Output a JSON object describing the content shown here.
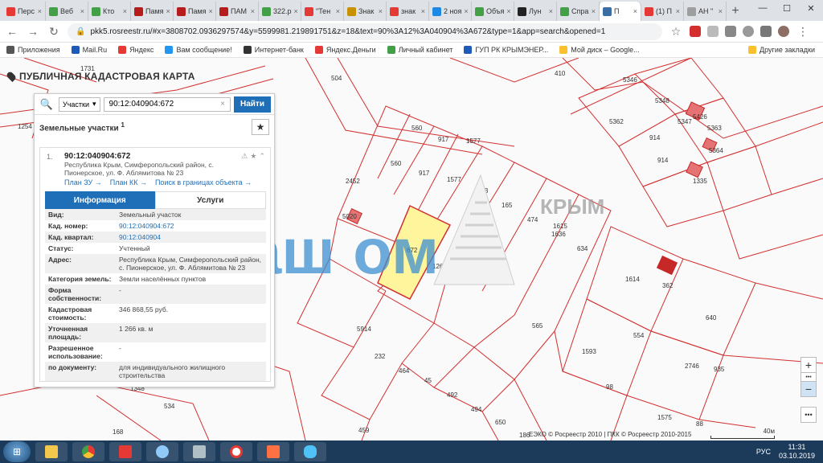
{
  "browser": {
    "tabs": [
      {
        "label": "Перс",
        "color": "#e53935"
      },
      {
        "label": "Веб",
        "color": "#43a047"
      },
      {
        "label": "Кто",
        "color": "#43a047"
      },
      {
        "label": "Памя",
        "color": "#b71c1c"
      },
      {
        "label": "Памя",
        "color": "#b71c1c"
      },
      {
        "label": "ПАМ",
        "color": "#b71c1c"
      },
      {
        "label": "322.р",
        "color": "#43a047"
      },
      {
        "label": "\"Тен",
        "color": "#e53935"
      },
      {
        "label": "Знак",
        "color": "#c79100"
      },
      {
        "label": "знак",
        "color": "#e53935"
      },
      {
        "label": "2 ноя",
        "color": "#1e88e5"
      },
      {
        "label": "Объя",
        "color": "#43a047"
      },
      {
        "label": "Лун",
        "color": "#222222"
      },
      {
        "label": "Спра",
        "color": "#43a047"
      },
      {
        "label": "П",
        "color": "#3b6fa3",
        "active": true
      },
      {
        "label": "(1) П",
        "color": "#e53935"
      },
      {
        "label": "АН \"",
        "color": "#9e9e9e"
      }
    ],
    "new_tab_label": "+",
    "url": "pkk5.rosreestr.ru/#x=3808702.0936297574&y=5599981.219891751&z=18&text=90%3A12%3A040904%3A672&type=1&app=search&opened=1",
    "bookmarks": [
      {
        "label": "Приложения",
        "color": "#555555"
      },
      {
        "label": "Mail.Ru",
        "color": "#1e5bb8"
      },
      {
        "label": "Яндекс",
        "color": "#e53935"
      },
      {
        "label": "Вам сообщение!",
        "color": "#2196f3"
      },
      {
        "label": "Интернет-банк",
        "color": "#333333"
      },
      {
        "label": "Яндекс.Деньги",
        "color": "#e53935"
      },
      {
        "label": "Личный кабинет",
        "color": "#43a047"
      },
      {
        "label": "ГУП РК КРЫМЭНЕР...",
        "color": "#1e5bb8"
      },
      {
        "label": "Мой диск – Google...",
        "color": "#fbc02d"
      }
    ],
    "other_bookmarks": "Другие закладки"
  },
  "app": {
    "title": "ПУБЛИЧНАЯ КАДАСТРОВАЯ КАРТА",
    "search": {
      "type_label": "Участки",
      "value": "90:12:040904:672",
      "button": "Найти"
    },
    "list_title": "Земельные участки",
    "list_count": "1",
    "result": {
      "index": "1.",
      "number": "90:12:040904:672",
      "address": "Республика Крым, Симферопольский район, с. Пионерское, ул. Ф. Аблямитова № 23",
      "links": [
        "План ЗУ →",
        "План КК →",
        "Поиск в границах объекта →"
      ],
      "tab_info": "Информация",
      "tab_services": "Услуги",
      "rows": [
        {
          "k": "Вид:",
          "v": "Земельный участок"
        },
        {
          "k": "Кад. номер:",
          "v": "90:12:040904:672",
          "link": true
        },
        {
          "k": "Кад. квартал:",
          "v": "90:12:040904",
          "link": true
        },
        {
          "k": "Статус:",
          "v": "Учтенный"
        },
        {
          "k": "Адрес:",
          "v": "Республика Крым, Симферопольский район, с. Пионерское, ул. Ф. Аблямитова № 23"
        },
        {
          "k": "Категория земель:",
          "v": "Земли населённых пунктов"
        },
        {
          "k": "Форма собственности:",
          "v": "-"
        },
        {
          "k": "Кадастровая стоимость:",
          "v": "346 868,55 руб."
        },
        {
          "k": "Уточненная площадь:",
          "v": "1 266 кв. м"
        },
        {
          "k": "Разрешенное использование:",
          "v": "-"
        },
        {
          "k": "по документу:",
          "v": "для индивидуального жилищного строительства"
        }
      ]
    },
    "map_labels": [
      "1731",
      "504",
      "410",
      "5346",
      "5348",
      "1254",
      "5362",
      "5347",
      "5426",
      "560",
      "917",
      "1577",
      "914",
      "5363",
      "5364",
      "914",
      "1335",
      "560",
      "917",
      "1577",
      "2452",
      "123",
      "165",
      "474",
      "1615",
      "1636",
      "634",
      "5020",
      "672",
      "126",
      "113",
      "1614",
      "362",
      "5914",
      "565",
      "640",
      "554",
      "1593",
      "2746",
      "232",
      "464",
      "45",
      "492",
      "98",
      "1575",
      "88",
      "1348",
      "534",
      "494",
      "650",
      "459",
      "168",
      "186",
      "935"
    ],
    "watermark_main": "Ваш  ом",
    "watermark_small": "КРЫМ",
    "zoom_in": "+",
    "zoom_out": "−",
    "more": "•••",
    "copyright": "ЕЭКО © Росреестр 2010 | ПКК © Росреестр 2010-2015",
    "scale": "40м"
  },
  "taskbar": {
    "lang": "РУС",
    "time": "11:31",
    "date": "03.10.2019"
  },
  "colors": {
    "accent": "#1f6fb8",
    "parcel_line": "#d32f2f",
    "selected_fill": "#fff59d",
    "watermark": "#3d8fd1"
  }
}
